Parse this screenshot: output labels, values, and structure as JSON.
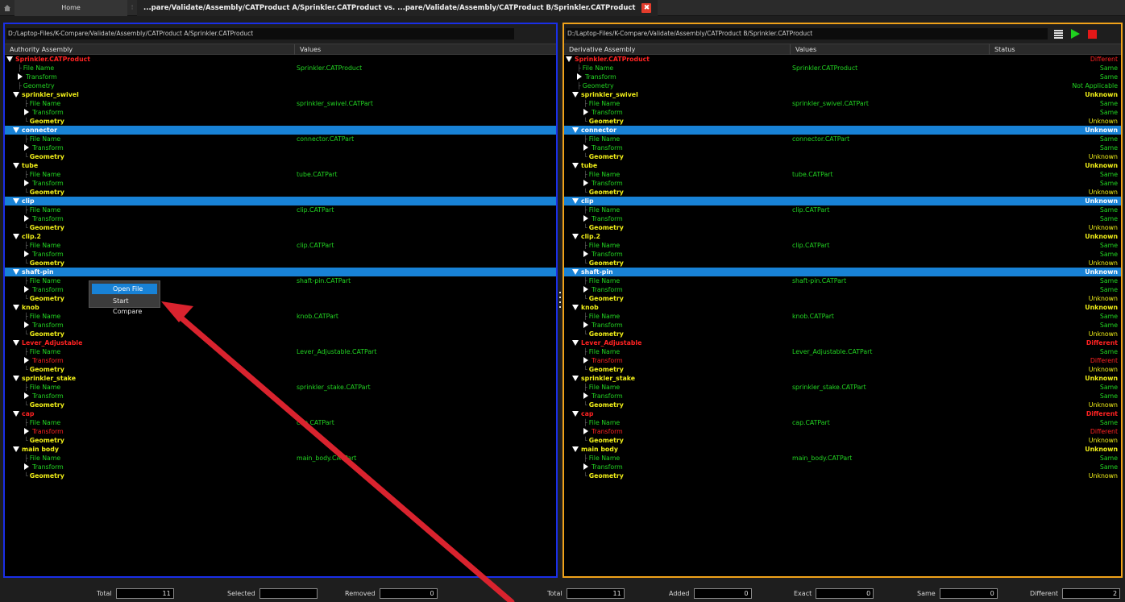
{
  "tabs": {
    "home_label": "Home",
    "doc_label": "...pare/Validate/Assembly/CATProduct A/Sprinkler.CATProduct vs. ...pare/Validate/Assembly/CATProduct B/Sprinkler.CATProduct",
    "close_glyph": "✖",
    "separator_glyph": "⁝"
  },
  "left": {
    "path": "D:/Laptop-Files/K-Compare/Validate/Assembly/CATProduct A/Sprinkler.CATProduct",
    "columns": [
      "Authority Assembly",
      "Values"
    ]
  },
  "right": {
    "path": "D:/Laptop-Files/K-Compare/Validate/Assembly/CATProduct B/Sprinkler.CATProduct",
    "columns": [
      "Derivative Assembly",
      "Values",
      "Status"
    ]
  },
  "tree": [
    {
      "label": "Sprinkler.CATProduct",
      "kind": "root",
      "color": "redb",
      "value": "",
      "status": "Different",
      "status_style": "diff",
      "selected": false
    },
    {
      "label": "File Name",
      "kind": "leaf",
      "color": "green",
      "value": "Sprinkler.CATProduct",
      "status": "Same",
      "status_style": "same",
      "selected": false
    },
    {
      "label": "Transform",
      "kind": "expand",
      "color": "green",
      "value": "",
      "status": "Same",
      "status_style": "same",
      "selected": false
    },
    {
      "label": "Geometry",
      "kind": "leaf",
      "color": "green",
      "value": "",
      "status": "Not Applicable",
      "status_style": "na",
      "selected": false
    },
    {
      "label": "sprinkler_swivel",
      "kind": "part",
      "color": "yellow",
      "value": "",
      "status": "Unknown",
      "status_style": "unkb",
      "selected": false
    },
    {
      "label": "File Name",
      "kind": "subleaf",
      "color": "green",
      "value": "sprinkler_swivel.CATPart",
      "status": "Same",
      "status_style": "same",
      "selected": false
    },
    {
      "label": "Transform",
      "kind": "subexpand",
      "color": "green",
      "value": "",
      "status": "Same",
      "status_style": "same",
      "selected": false
    },
    {
      "label": "Geometry",
      "kind": "sublast",
      "color": "yellow",
      "value": "",
      "status": "Unknown",
      "status_style": "unk",
      "selected": false
    },
    {
      "label": "connector",
      "kind": "part",
      "color": "white",
      "value": "",
      "status": "Unknown",
      "status_style": "unkb-w",
      "selected": true
    },
    {
      "label": "File Name",
      "kind": "subleaf",
      "color": "green",
      "value": "connector.CATPart",
      "status": "Same",
      "status_style": "same",
      "selected": false
    },
    {
      "label": "Transform",
      "kind": "subexpand",
      "color": "green",
      "value": "",
      "status": "Same",
      "status_style": "same",
      "selected": false
    },
    {
      "label": "Geometry",
      "kind": "sublast",
      "color": "yellow",
      "value": "",
      "status": "Unknown",
      "status_style": "unk",
      "selected": false
    },
    {
      "label": "tube",
      "kind": "part",
      "color": "yellow",
      "value": "",
      "status": "Unknown",
      "status_style": "unkb",
      "selected": false
    },
    {
      "label": "File Name",
      "kind": "subleaf",
      "color": "green",
      "value": "tube.CATPart",
      "status": "Same",
      "status_style": "same",
      "selected": false
    },
    {
      "label": "Transform",
      "kind": "subexpand",
      "color": "green",
      "value": "",
      "status": "Same",
      "status_style": "same",
      "selected": false
    },
    {
      "label": "Geometry",
      "kind": "sublast",
      "color": "yellow",
      "value": "",
      "status": "Unknown",
      "status_style": "unk",
      "selected": false
    },
    {
      "label": "clip",
      "kind": "part",
      "color": "white",
      "value": "",
      "status": "Unknown",
      "status_style": "unkb-w",
      "selected": true
    },
    {
      "label": "File Name",
      "kind": "subleaf",
      "color": "green",
      "value": "clip.CATPart",
      "status": "Same",
      "status_style": "same",
      "selected": false
    },
    {
      "label": "Transform",
      "kind": "subexpand",
      "color": "green",
      "value": "",
      "status": "Same",
      "status_style": "same",
      "selected": false
    },
    {
      "label": "Geometry",
      "kind": "sublast",
      "color": "yellow",
      "value": "",
      "status": "Unknown",
      "status_style": "unk",
      "selected": false
    },
    {
      "label": "clip.2",
      "kind": "part",
      "color": "yellow",
      "value": "",
      "status": "Unknown",
      "status_style": "unkb",
      "selected": false
    },
    {
      "label": "File Name",
      "kind": "subleaf",
      "color": "green",
      "value": "clip.CATPart",
      "status": "Same",
      "status_style": "same",
      "selected": false
    },
    {
      "label": "Transform",
      "kind": "subexpand",
      "color": "green",
      "value": "",
      "status": "Same",
      "status_style": "same",
      "selected": false
    },
    {
      "label": "Geometry",
      "kind": "sublast",
      "color": "yellow",
      "value": "",
      "status": "Unknown",
      "status_style": "unk",
      "selected": false
    },
    {
      "label": "shaft-pin",
      "kind": "part",
      "color": "white",
      "value": "",
      "status": "Unknown",
      "status_style": "unkb-w",
      "selected": true
    },
    {
      "label": "File Name",
      "kind": "subleaf",
      "color": "green",
      "value": "shaft-pin.CATPart",
      "status": "Same",
      "status_style": "same",
      "selected": false
    },
    {
      "label": "Transform",
      "kind": "subexpand",
      "color": "green",
      "value": "",
      "status": "Same",
      "status_style": "same",
      "selected": false
    },
    {
      "label": "Geometry",
      "kind": "sublast",
      "color": "yellow",
      "value": "",
      "status": "Unknown",
      "status_style": "unk",
      "selected": false
    },
    {
      "label": "knob",
      "kind": "part",
      "color": "yellow",
      "value": "",
      "status": "Unknown",
      "status_style": "unkb",
      "selected": false
    },
    {
      "label": "File Name",
      "kind": "subleaf",
      "color": "green",
      "value": "knob.CATPart",
      "status": "Same",
      "status_style": "same",
      "selected": false
    },
    {
      "label": "Transform",
      "kind": "subexpand",
      "color": "green",
      "value": "",
      "status": "Same",
      "status_style": "same",
      "selected": false
    },
    {
      "label": "Geometry",
      "kind": "sublast",
      "color": "yellow",
      "value": "",
      "status": "Unknown",
      "status_style": "unk",
      "selected": false
    },
    {
      "label": "Lever_Adjustable",
      "kind": "part",
      "color": "redb",
      "value": "",
      "status": "Different",
      "status_style": "diffb",
      "selected": false
    },
    {
      "label": "File Name",
      "kind": "subleaf",
      "color": "green",
      "value": "Lever_Adjustable.CATPart",
      "status": "Same",
      "status_style": "same",
      "selected": false
    },
    {
      "label": "Transform",
      "kind": "subexpand",
      "color": "red",
      "value": "",
      "status": "Different",
      "status_style": "diff",
      "selected": false
    },
    {
      "label": "Geometry",
      "kind": "sublast",
      "color": "yellow",
      "value": "",
      "status": "Unknown",
      "status_style": "unk",
      "selected": false
    },
    {
      "label": "sprinkler_stake",
      "kind": "part",
      "color": "yellow",
      "value": "",
      "status": "Unknown",
      "status_style": "unkb",
      "selected": false
    },
    {
      "label": "File Name",
      "kind": "subleaf",
      "color": "green",
      "value": "sprinkler_stake.CATPart",
      "status": "Same",
      "status_style": "same",
      "selected": false
    },
    {
      "label": "Transform",
      "kind": "subexpand",
      "color": "green",
      "value": "",
      "status": "Same",
      "status_style": "same",
      "selected": false
    },
    {
      "label": "Geometry",
      "kind": "sublast",
      "color": "yellow",
      "value": "",
      "status": "Unknown",
      "status_style": "unk",
      "selected": false
    },
    {
      "label": "cap",
      "kind": "part",
      "color": "redb",
      "value": "",
      "status": "Different",
      "status_style": "diffb",
      "selected": false
    },
    {
      "label": "File Name",
      "kind": "subleaf",
      "color": "green",
      "value": "cap.CATPart",
      "status": "Same",
      "status_style": "same",
      "selected": false
    },
    {
      "label": "Transform",
      "kind": "subexpand",
      "color": "red",
      "value": "",
      "status": "Different",
      "status_style": "diff",
      "selected": false
    },
    {
      "label": "Geometry",
      "kind": "sublast",
      "color": "yellow",
      "value": "",
      "status": "Unknown",
      "status_style": "unk",
      "selected": false
    },
    {
      "label": "main body",
      "kind": "part",
      "color": "yellow",
      "value": "",
      "status": "Unknown",
      "status_style": "unkb",
      "selected": false
    },
    {
      "label": "File Name",
      "kind": "subleaf",
      "color": "green",
      "value": "main_body.CATPart",
      "status": "Same",
      "status_style": "same",
      "selected": false
    },
    {
      "label": "Transform",
      "kind": "subexpand",
      "color": "green",
      "value": "",
      "status": "Same",
      "status_style": "same",
      "selected": false
    },
    {
      "label": "Geometry",
      "kind": "sublast",
      "color": "yellow",
      "value": "",
      "status": "Unknown",
      "status_style": "unk",
      "selected": false
    }
  ],
  "context_menu": {
    "items": [
      "Open File",
      "Start Compare"
    ]
  },
  "status_bar": {
    "left": [
      {
        "label": "Total",
        "value": "11"
      },
      {
        "label": "Selected",
        "value": ""
      },
      {
        "label": "Removed",
        "value": "0"
      }
    ],
    "right": [
      {
        "label": "Total",
        "value": "11"
      },
      {
        "label": "Added",
        "value": "0"
      },
      {
        "label": "Exact",
        "value": "0"
      },
      {
        "label": "Same",
        "value": "0"
      },
      {
        "label": "Different",
        "value": "2"
      }
    ]
  },
  "colors": {
    "left_border": "#1a2fe8",
    "right_border": "#f0a21a",
    "selection": "#1882d6",
    "same": "#22d522",
    "different": "#ff2222",
    "unknown": "#f0ee18",
    "arrow": "#d9232e"
  },
  "icons": {
    "home": "home-icon",
    "list": "list-icon",
    "run": "play-icon",
    "stop": "stop-icon"
  }
}
